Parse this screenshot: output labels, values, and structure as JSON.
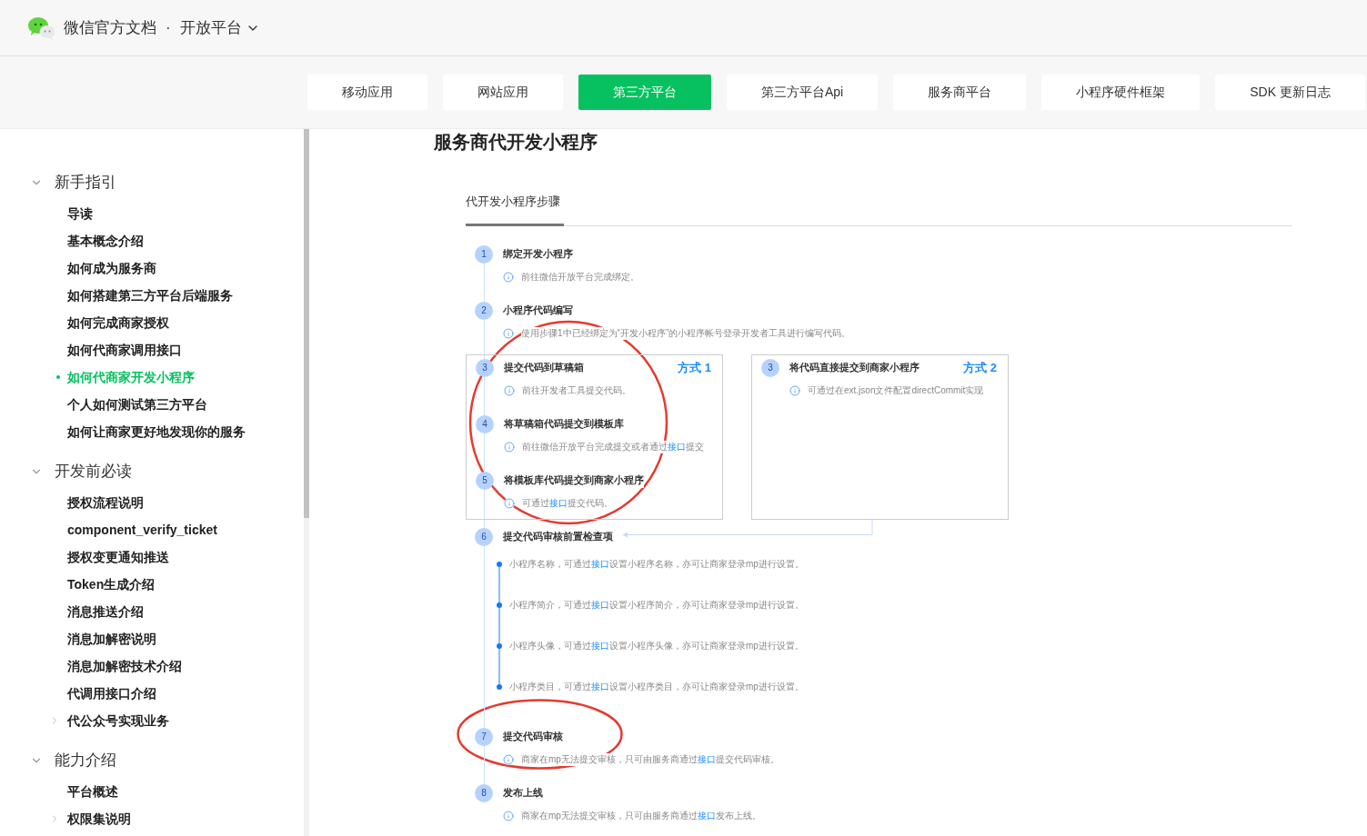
{
  "header": {
    "site_title": "微信官方文档",
    "separator": "·",
    "platform": "开放平台"
  },
  "nav_tabs": [
    {
      "label": "移动应用",
      "selected": false
    },
    {
      "label": "网站应用",
      "selected": false
    },
    {
      "label": "第三方平台",
      "selected": true
    },
    {
      "label": "第三方平台Api",
      "selected": false
    },
    {
      "label": "服务商平台",
      "selected": false
    },
    {
      "label": "小程序硬件框架",
      "selected": false
    },
    {
      "label": "SDK 更新日志",
      "selected": false
    }
  ],
  "sidebar": {
    "sections": [
      {
        "title": "新手指引",
        "expanded": true,
        "items": [
          {
            "label": "导读",
            "selected": false,
            "expandable": false
          },
          {
            "label": "基本概念介绍",
            "selected": false,
            "expandable": false
          },
          {
            "label": "如何成为服务商",
            "selected": false,
            "expandable": false
          },
          {
            "label": "如何搭建第三方平台后端服务",
            "selected": false,
            "expandable": false
          },
          {
            "label": "如何完成商家授权",
            "selected": false,
            "expandable": false
          },
          {
            "label": "如何代商家调用接口",
            "selected": false,
            "expandable": false
          },
          {
            "label": "如何代商家开发小程序",
            "selected": true,
            "expandable": false
          },
          {
            "label": "个人如何测试第三方平台",
            "selected": false,
            "expandable": false
          },
          {
            "label": "如何让商家更好地发现你的服务",
            "selected": false,
            "expandable": false
          }
        ]
      },
      {
        "title": "开发前必读",
        "expanded": true,
        "items": [
          {
            "label": "授权流程说明",
            "selected": false,
            "expandable": false
          },
          {
            "label": "component_verify_ticket",
            "selected": false,
            "expandable": false
          },
          {
            "label": "授权变更通知推送",
            "selected": false,
            "expandable": false
          },
          {
            "label": "Token生成介绍",
            "selected": false,
            "expandable": false
          },
          {
            "label": "消息推送介绍",
            "selected": false,
            "expandable": false
          },
          {
            "label": "消息加解密说明",
            "selected": false,
            "expandable": false
          },
          {
            "label": "消息加解密技术介绍",
            "selected": false,
            "expandable": false
          },
          {
            "label": "代调用接口介绍",
            "selected": false,
            "expandable": false
          },
          {
            "label": "代公众号实现业务",
            "selected": false,
            "expandable": true
          }
        ]
      },
      {
        "title": "能力介绍",
        "expanded": true,
        "items": [
          {
            "label": "平台概述",
            "selected": false,
            "expandable": false
          },
          {
            "label": "权限集说明",
            "selected": false,
            "expandable": true
          }
        ]
      }
    ]
  },
  "article": {
    "title": "服务商代开发小程序",
    "tab": "代开发小程序步骤",
    "steps_before": [
      {
        "number": "1",
        "title": "绑定开发小程序",
        "desc": [
          {
            "text": "前往微信开放平台完成绑定。",
            "link": false
          }
        ]
      },
      {
        "number": "2",
        "title": "小程序代码编写",
        "desc": [
          {
            "text": "使用步骤1中已经绑定为“开发小程序”的小程序帐号登录开发者工具进行编写代码。",
            "link": false
          }
        ]
      }
    ],
    "options": [
      {
        "label": "方式 1",
        "steps": [
          {
            "number": "3",
            "title": "提交代码到草稿箱",
            "desc": [
              {
                "text": "前往开发者工具提交代码。",
                "link": false
              }
            ]
          },
          {
            "number": "4",
            "title": "将草稿箱代码提交到模板库",
            "desc": [
              {
                "text": "前往微信开放平台完成提交或者通过",
                "link": false
              },
              {
                "text": "接口",
                "link": true
              },
              {
                "text": "提交",
                "link": false
              }
            ]
          },
          {
            "number": "5",
            "title": "将模板库代码提交到商家小程序",
            "desc": [
              {
                "text": "可通过",
                "link": false
              },
              {
                "text": "接口",
                "link": true
              },
              {
                "text": "提交代码。",
                "link": false
              }
            ]
          }
        ]
      },
      {
        "label": "方式 2",
        "steps": [
          {
            "number": "3",
            "title": "将代码直接提交到商家小程序",
            "desc": [
              {
                "text": "可通过在ext.json文件配置directCommit实现",
                "link": false
              }
            ]
          }
        ]
      }
    ],
    "checklist_step": {
      "number": "6",
      "title": "提交代码审核前置检查项",
      "checks": [
        [
          {
            "text": "小程序名称，可通过",
            "link": false
          },
          {
            "text": "接口",
            "link": true
          },
          {
            "text": "设置小程序名称，亦可让商家登录mp进行设置。",
            "link": false
          }
        ],
        [
          {
            "text": "小程序简介，可通过",
            "link": false
          },
          {
            "text": "接口",
            "link": true
          },
          {
            "text": "设置小程序简介，亦可让商家登录mp进行设置。",
            "link": false
          }
        ],
        [
          {
            "text": "小程序头像，可通过",
            "link": false
          },
          {
            "text": "接口",
            "link": true
          },
          {
            "text": "设置小程序头像，亦可让商家登录mp进行设置。",
            "link": false
          }
        ],
        [
          {
            "text": "小程序类目，可通过",
            "link": false
          },
          {
            "text": "接口",
            "link": true
          },
          {
            "text": "设置小程序类目，亦可让商家登录mp进行设置。",
            "link": false
          }
        ]
      ]
    },
    "steps_after": [
      {
        "number": "7",
        "title": "提交代码审核",
        "desc": [
          {
            "text": "商家在mp无法提交审核，只可由服务商通过",
            "link": false
          },
          {
            "text": "接口",
            "link": true
          },
          {
            "text": "提交代码审核。",
            "link": false
          }
        ]
      },
      {
        "number": "8",
        "title": "发布上线",
        "desc": [
          {
            "text": "商家在mp无法提交审核，只可由服务商通过",
            "link": false
          },
          {
            "text": "接口",
            "link": true
          },
          {
            "text": "发布上线。",
            "link": false
          }
        ]
      }
    ]
  }
}
